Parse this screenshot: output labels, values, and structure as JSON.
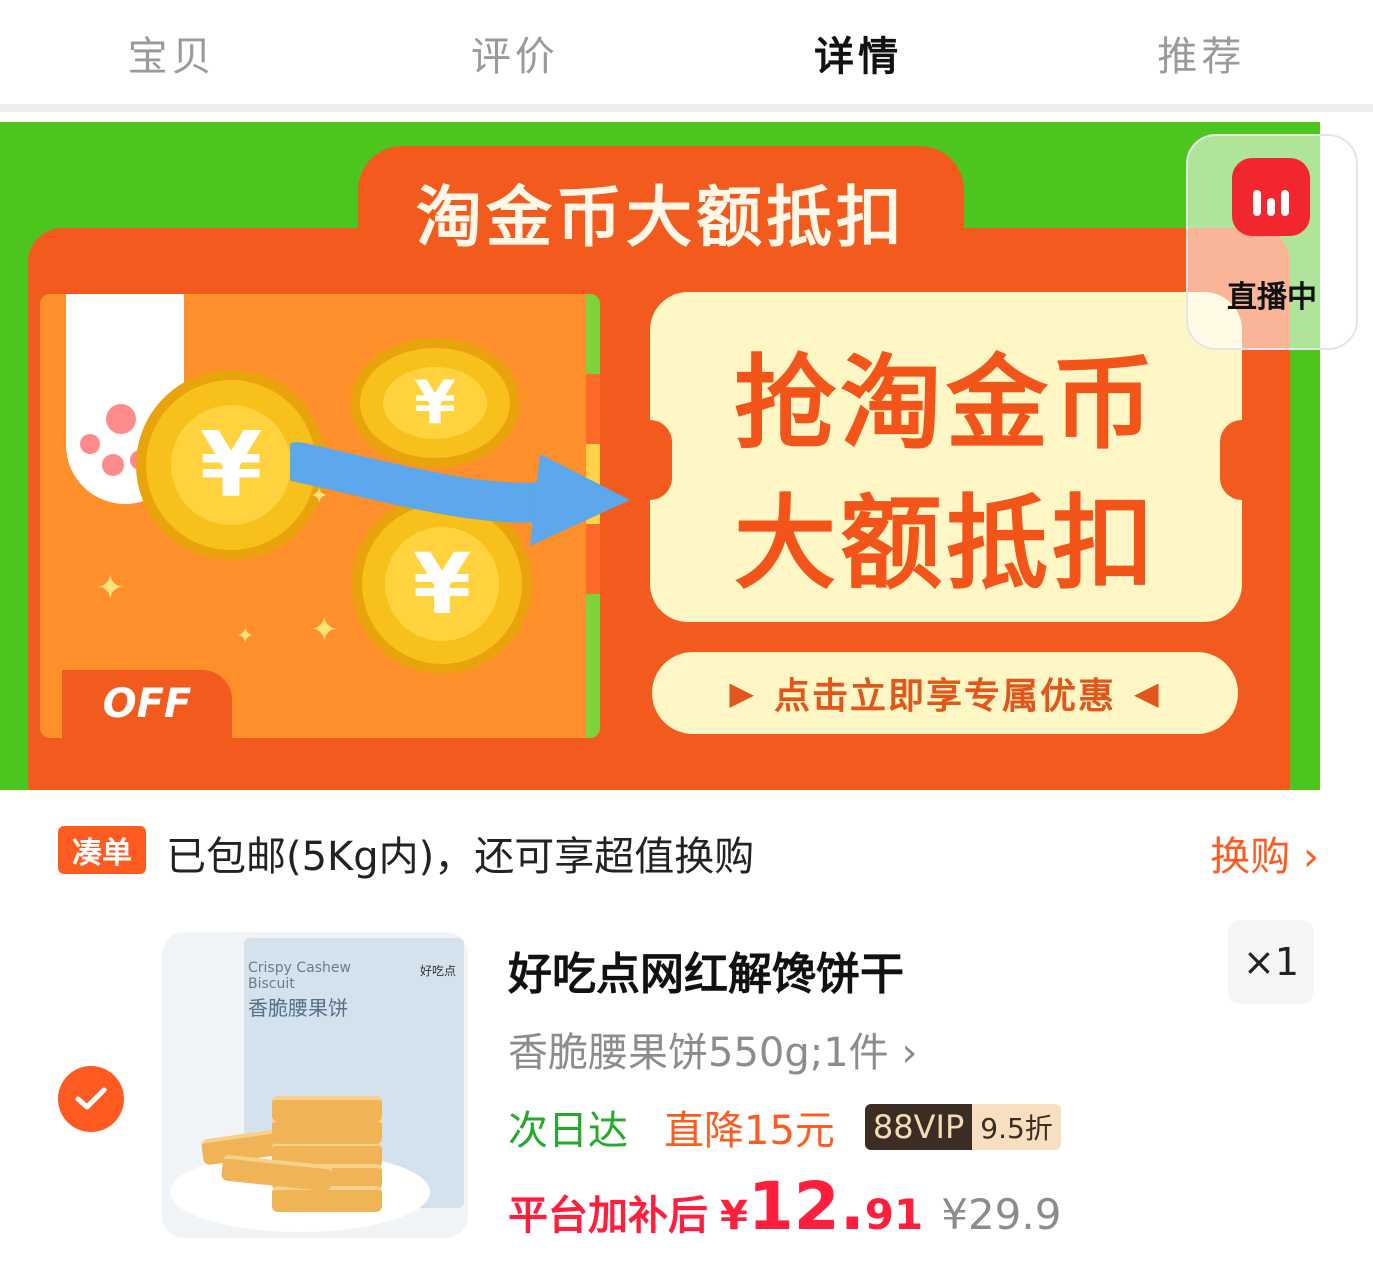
{
  "tabs": [
    {
      "label": "宝贝",
      "active": false
    },
    {
      "label": "评价",
      "active": false
    },
    {
      "label": "详情",
      "active": true
    },
    {
      "label": "推荐",
      "active": false
    }
  ],
  "banner": {
    "headline": "淘金币大额抵扣",
    "ticket_line1": "抢淘金币",
    "ticket_line2": "大额抵扣",
    "cta": "点击立即享专属优惠",
    "off_label": "OFF",
    "coin_symbol": "¥",
    "colors": {
      "background": "#4cc51f",
      "frame": "#f35b1e",
      "ticket": "#fff6c5"
    }
  },
  "live": {
    "label": "直播中",
    "icon": "live-bars-icon"
  },
  "promo": {
    "badge": "凑单",
    "text": "已包邮(5Kg内)，还可享超值换购",
    "link": "换购"
  },
  "product": {
    "title": "好吃点网红解馋饼干",
    "quantity": "×1",
    "variant": "香脆腰果饼550g;1件",
    "tag_next_day": "次日达",
    "tag_price_drop": "直降15元",
    "vip_label": "88VIP",
    "vip_discount": "9.5折",
    "price_label": "平台加补后",
    "price_currency": "¥",
    "price_integer": "12.",
    "price_decimal": "91",
    "original_price": "¥29.9",
    "selected": true,
    "package_en_line1": "Crispy Cashew",
    "package_en_line2": "Biscuit",
    "package_cn": "香脆腰果饼",
    "package_brand": "好吃点"
  },
  "accent_color": "#ff5a1f"
}
